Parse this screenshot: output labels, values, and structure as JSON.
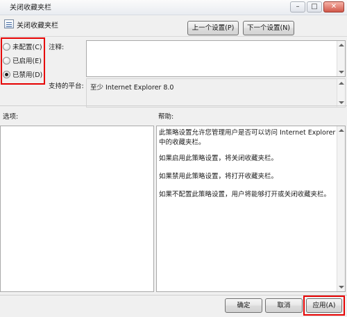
{
  "window": {
    "title": "关闭收藏夹栏",
    "minimize": "–",
    "maximize": "□",
    "close": "✕"
  },
  "header": {
    "policy_name": "关闭收藏夹栏",
    "prev_button": "上一个设置(P)",
    "next_button": "下一个设置(N)"
  },
  "state": {
    "options": [
      {
        "label": "未配置(C)",
        "selected": false
      },
      {
        "label": "已启用(E)",
        "selected": false
      },
      {
        "label": "已禁用(D)",
        "selected": true
      }
    ]
  },
  "comment": {
    "label": "注释:",
    "value": ""
  },
  "platform": {
    "label": "支持的平台:",
    "value": "至少 Internet Explorer 8.0"
  },
  "options_panel": {
    "label": "选项:"
  },
  "help_panel": {
    "label": "帮助:",
    "paragraphs": [
      "此策略设置允许您管理用户是否可以访问 Internet Explorer 中的收藏夹栏。",
      "如果启用此策略设置，将关闭收藏夹栏。",
      "如果禁用此策略设置，将打开收藏夹栏。",
      "如果不配置此策略设置，用户将能够打开或关闭收藏夹栏。"
    ]
  },
  "footer": {
    "ok": "确定",
    "cancel": "取消",
    "apply": "应用(A)"
  },
  "colors": {
    "highlight_border": "#e60000",
    "background": "#f0f0f0"
  }
}
